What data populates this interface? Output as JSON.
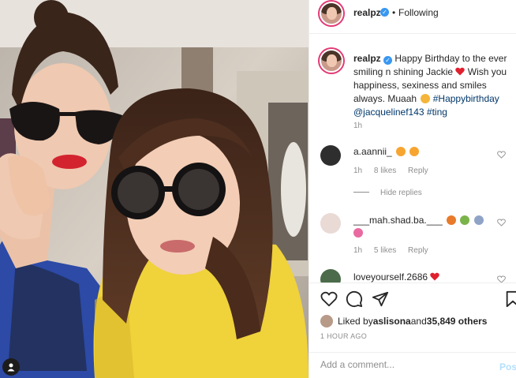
{
  "post": {
    "username": "realpz",
    "follow_status": "Following",
    "dot": "•"
  },
  "caption": {
    "username": "realpz",
    "text_a": "Happy Birthday to the ever smiling n shining Jackie",
    "text_b": "Wish you happiness, sexiness and smiles always. Muaah",
    "hashtag": "#Happybirthday",
    "mention": "@jacquelinef143",
    "hashtag2": "#ting",
    "time": "1h"
  },
  "comments": [
    {
      "username": "a.aannii_",
      "time": "1h",
      "likes": "8 likes",
      "reply": "Reply"
    },
    {
      "username": "___mah.shad.ba.___",
      "time": "1h",
      "likes": "5 likes",
      "reply": "Reply"
    },
    {
      "username": "loveyourself.2686"
    }
  ],
  "hide_replies": "Hide replies",
  "likes": {
    "prefix": "Liked by ",
    "user": "aslisona",
    "middle": " and ",
    "count": "35,849 others"
  },
  "post_time": "1 HOUR AGO",
  "add_comment": {
    "placeholder": "Add a comment...",
    "post_label": "Post"
  },
  "icons": {
    "heart": "heart-icon",
    "comment": "comment-icon",
    "share": "share-icon",
    "save": "bookmark-icon",
    "verified": "verified-icon",
    "tag": "person-tag-icon"
  },
  "colors": {
    "verified_blue": "#3897f0",
    "link": "#00376b",
    "heart_red": "#ed4956",
    "post_button": "#b2dffc"
  }
}
